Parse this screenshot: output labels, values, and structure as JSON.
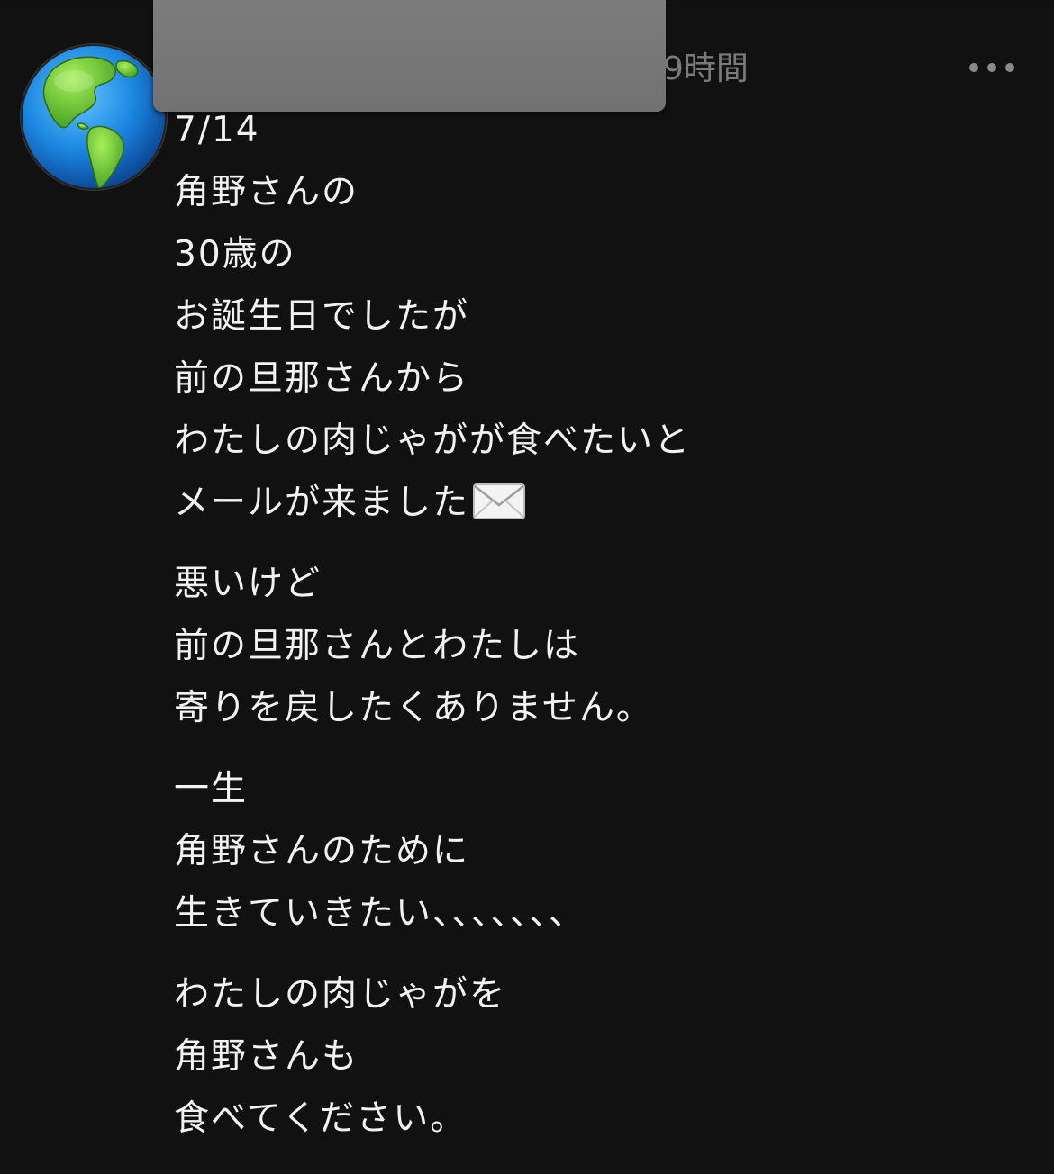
{
  "post": {
    "timestamp": "9時間",
    "more_icon": "more-horizontal-icon",
    "avatar_icon": "globe-americas-icon",
    "paragraphs": [
      [
        "7/14",
        "角野さんの",
        "30歳の",
        "お誕生日でしたが",
        "前の旦那さんから",
        "わたしの肉じゃがが食べたいと",
        "メールが来ました"
      ],
      [
        "悪いけど",
        "前の旦那さんとわたしは",
        "寄りを戻したくありません。"
      ],
      [
        "一生",
        "角野さんのために",
        "生きていきたい、、、、、、、"
      ],
      [
        "わたしの肉じゃがを",
        "角野さんも",
        "食べてください。"
      ]
    ],
    "emoji_after_line": "envelope-icon"
  },
  "colors": {
    "background": "#111111",
    "text": "#f2f2f2",
    "muted": "#7a7a7a",
    "redaction": "#777777"
  }
}
